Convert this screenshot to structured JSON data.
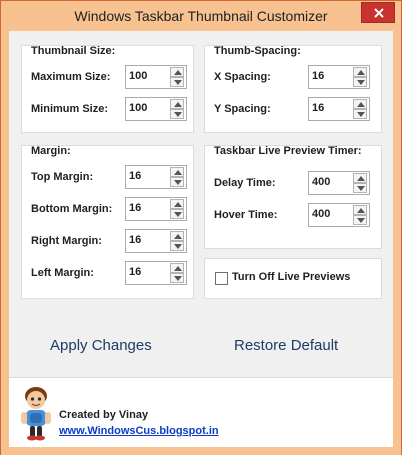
{
  "window": {
    "title": "Windows Taskbar Thumbnail Customizer"
  },
  "thumbnail_size": {
    "title": "Thumbnail Size:",
    "maximum_label": "Maximum Size:",
    "maximum_value": "100",
    "minimum_label": "Minimum Size:",
    "minimum_value": "100"
  },
  "thumb_spacing": {
    "title": "Thumb-Spacing:",
    "x_label": "X Spacing:",
    "x_value": "16",
    "y_label": "Y Spacing:",
    "y_value": "16"
  },
  "margin": {
    "title": "Margin:",
    "top_label": "Top Margin:",
    "top_value": "16",
    "bottom_label": "Bottom Margin:",
    "bottom_value": "16",
    "right_label": "Right Margin:",
    "right_value": "16",
    "left_label": "Left Margin:",
    "left_value": "16"
  },
  "live_preview": {
    "title": "Taskbar Live Preview Timer:",
    "delay_label": "Delay Time:",
    "delay_value": "400",
    "hover_label": "Hover Time:",
    "hover_value": "400"
  },
  "options": {
    "turn_off_live_previews_label": "Turn Off Live Previews",
    "turn_off_live_previews_checked": false
  },
  "actions": {
    "apply_label": "Apply Changes",
    "restore_label": "Restore Default"
  },
  "footer": {
    "creator_text": "Created by Vinay",
    "link_text": "www.WindowsCus.blogspot.in"
  },
  "colors": {
    "title_bar": "#f7c28f",
    "close_button": "#c7342e",
    "link": "#0b3cc3",
    "action_text": "#1f3a66"
  }
}
